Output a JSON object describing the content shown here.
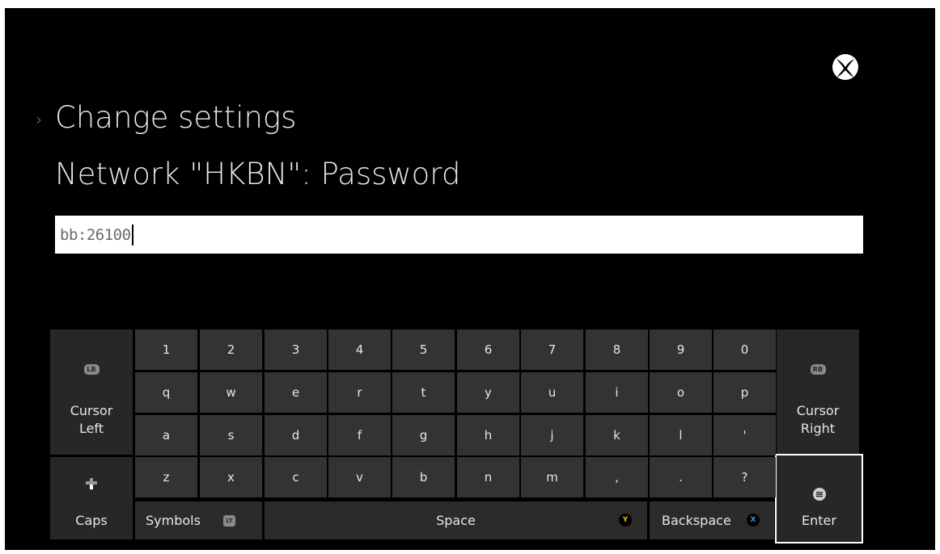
{
  "header": {
    "chevron": "›",
    "title": "Change settings",
    "subtitle": "Network \"HKBN\": Password"
  },
  "password_field": {
    "value": "bb:26100"
  },
  "keyboard": {
    "rows": [
      [
        "1",
        "2",
        "3",
        "4",
        "5",
        "6",
        "7",
        "8",
        "9",
        "0"
      ],
      [
        "q",
        "w",
        "e",
        "r",
        "t",
        "y",
        "u",
        "i",
        "o",
        "p"
      ],
      [
        "a",
        "s",
        "d",
        "f",
        "g",
        "h",
        "j",
        "k",
        "l",
        "'"
      ],
      [
        "z",
        "x",
        "c",
        "v",
        "b",
        "n",
        "m",
        ",",
        ".",
        "?"
      ]
    ],
    "cursor_left": {
      "badge": "LB",
      "label_line1": "Cursor",
      "label_line2": "Left"
    },
    "cursor_right": {
      "badge": "RB",
      "label_line1": "Cursor",
      "label_line2": "Right"
    },
    "caps": {
      "label": "Caps"
    },
    "enter": {
      "label": "Enter"
    },
    "symbols": {
      "label": "Symbols",
      "badge": "LT"
    },
    "space": {
      "label": "Space",
      "badge": "Y"
    },
    "backspace": {
      "label": "Backspace",
      "badge": "X"
    }
  },
  "colors": {
    "y_button": "#e6c200",
    "x_button": "#2a9fd6",
    "key_bg": "#333333",
    "side_key_bg": "#272727",
    "background": "#000000"
  },
  "icons": {
    "logo": "xbox-logo-icon",
    "caps": "dpad-down-icon",
    "enter": "menu-button-icon"
  }
}
